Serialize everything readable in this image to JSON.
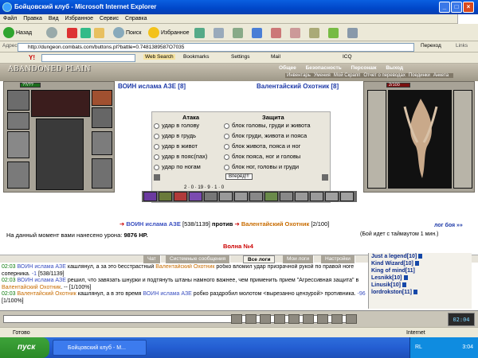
{
  "window": {
    "title": "Бойцовский клуб - Microsoft Internet Explorer"
  },
  "menu": [
    "Файл",
    "Правка",
    "Вид",
    "Избранное",
    "Сервис",
    "Справка"
  ],
  "toolbar": {
    "back": "Назад",
    "search": "Поиск",
    "favorites": "Избранное"
  },
  "address": {
    "label": "Адрес",
    "url": "http://dungeon.combats.com/buttons.pl?battle=0.7481389587O7035",
    "go": "Переход",
    "links": "Links"
  },
  "links_bar": {
    "web_search": "Web Search",
    "bookmarks": "Bookmarks",
    "settings": "Settings",
    "mail": "Mail",
    "icq": "ICQ"
  },
  "site": {
    "logo": "ABANDONED PLAIN",
    "nav": [
      "Общее",
      "Безопасность",
      "Персонаж",
      "Выход"
    ],
    "subnav": [
      "Инвентарь",
      "Умения",
      "Мой Скрапп",
      "Отчет о переводах",
      "Поединки",
      "Анкета"
    ]
  },
  "battle": {
    "left_hp": "??/??",
    "right_hp": "2/100",
    "left_name": "ВОИН ислама АЗЕ [8]",
    "right_name": "Валентайский Охотник [8]",
    "attack_header": "Атака",
    "defense_header": "Защита",
    "attack_options": [
      "удар в голову",
      "удар в грудь",
      "удар в живот",
      "удар в пояс(пах)",
      "удар по ногам"
    ],
    "defense_options": [
      "блок головы, груди и живота",
      "блок груди, живота и пояса",
      "блок живота, пояса и ног",
      "блок пояса, ног и головы",
      "блок ног, головы и груди"
    ],
    "go_button": "Вперёд!!!",
    "stats": [
      "2",
      "0",
      "19",
      "9",
      "1",
      "0"
    ],
    "versus_left": "ВОИН ислама АЗЕ",
    "versus_left_hp": "[538/1139]",
    "versus_word": "против",
    "versus_right": "Валентайский Охотник",
    "versus_right_hp": "[2/100]",
    "damage_label": "На данный момент вами нанесено урона:",
    "damage_value": "9876 HP.",
    "timeout_label": "лог боя »»",
    "timeout_text": "(Бой идет с таймаутом 1 мин.)",
    "wave": "Волна №4"
  },
  "chat_tabs": [
    "Чат",
    "Системные сообщения",
    "Все логи",
    "Мои логи",
    "Настройки"
  ],
  "log": [
    {
      "time": "02:03",
      "actor": "ВОИН ислама АЗЕ",
      "text": " кашлянул, а за это бесстрастный ",
      "target": "Валентайский Охотник",
      "rest": " робко вломил удар призрачной рукой по правой ноге соперника. ",
      "delta": "-1",
      "hp": " [538/1139]"
    },
    {
      "time": "02:03",
      "actor": "ВОИН ислама АЗЕ",
      "text": " решил, что завязать шнурки и подтянуть штаны намного важнее, чем применить прием \"Агрессивная защита\" в ",
      "target": "Валентайский Охотник",
      "rest": ". -- ",
      "delta": "",
      "hp": "[1/100%]"
    },
    {
      "time": "02:03",
      "actor": "Валентайский Охотник",
      "text": " кашлянул, а в это время ",
      "target": "ВОИН ислама АЗЕ",
      "rest": " робко раздробил молотом <вырезанно цензурой> противника. ",
      "delta": "-96",
      "hp": " [1/100%]"
    }
  ],
  "users": [
    "Just a legend[10]",
    "Kind Wizard[10]",
    "King of mind[11]",
    "Lesnikk[10]",
    "Linusik[10]",
    "lordrokston[11]"
  ],
  "clock": "02:04",
  "status": {
    "text": "Готово",
    "zone": "Internet"
  },
  "taskbar": {
    "start": "пуск",
    "item": "Бойцовский клуб - M...",
    "lang": "RL",
    "time": "3:04"
  }
}
